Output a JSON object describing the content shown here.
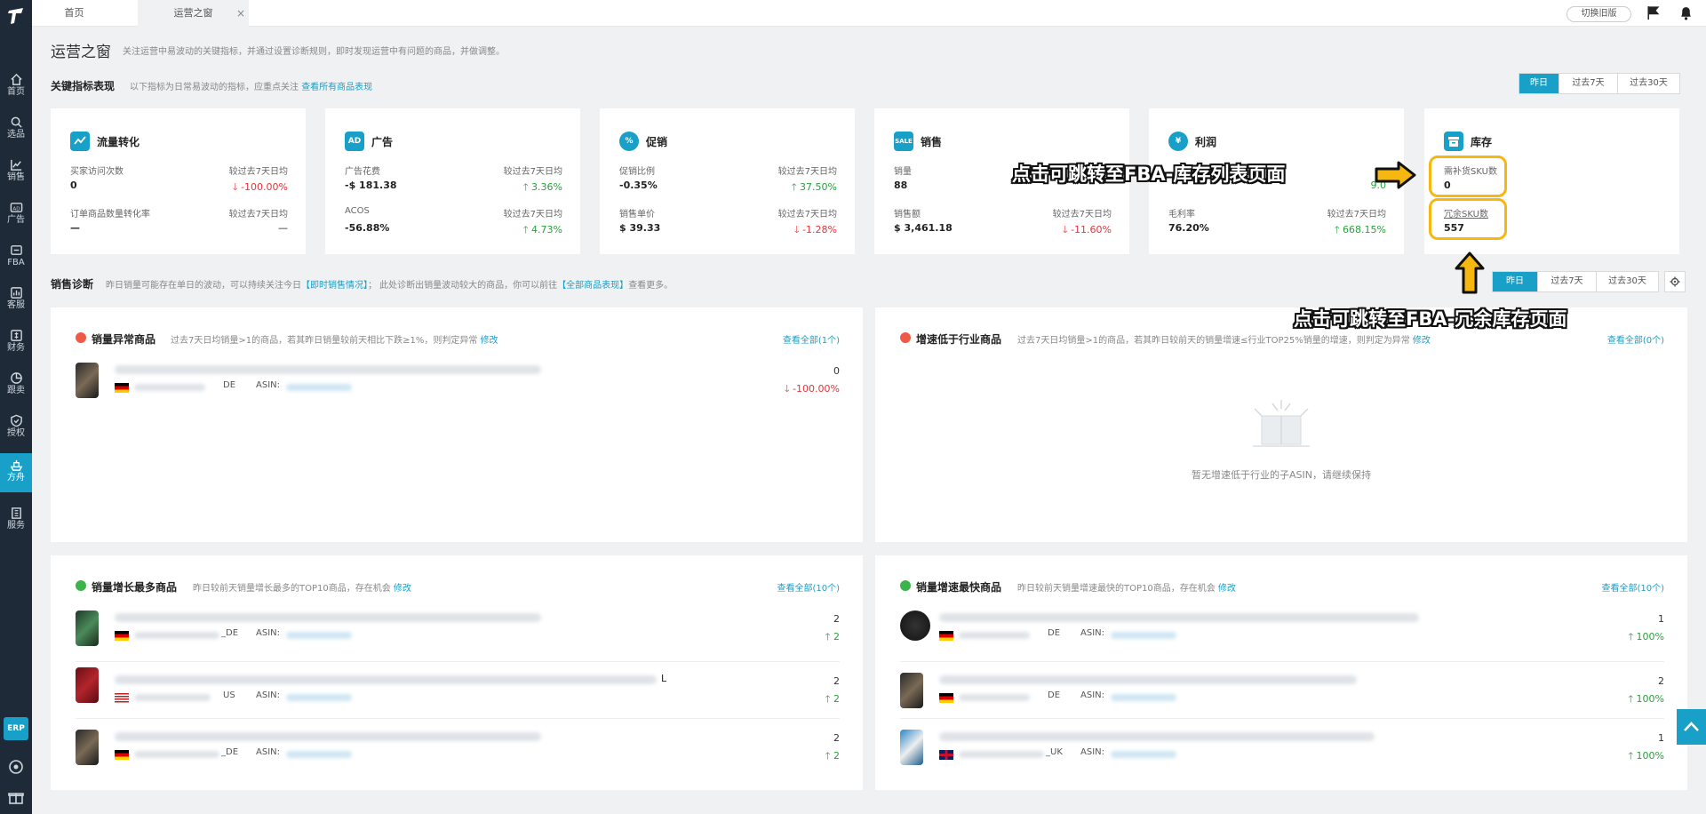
{
  "tabs": {
    "home": "首页",
    "ops": "运营之窗",
    "close": "×"
  },
  "topbar": {
    "old_version": "切换旧版"
  },
  "sidebar": {
    "items": [
      "首页",
      "选品",
      "销售",
      "广告",
      "FBA",
      "客服",
      "财务",
      "跟卖",
      "授权",
      "方舟",
      "服务"
    ],
    "active": "方舟",
    "erp": "ERP"
  },
  "page": {
    "title": "运营之窗",
    "desc": "关注运营中易波动的关键指标，并通过设置诊断规则，即时发现运营中有问题的商品，并做调整。"
  },
  "kpi": {
    "title": "关键指标表现",
    "desc": "以下指标为日常易波动的指标，应重点关注",
    "link": "查看所有商品表现",
    "periods": [
      "昨日",
      "过去7天",
      "过去30天"
    ],
    "active_period": "昨日",
    "compare_label": "较过去7天日均",
    "cards": [
      {
        "title": "流量转化",
        "icon": "traffic-icon",
        "m1": {
          "label": "买家访问次数",
          "value": "0",
          "change": "-100.00%",
          "dir": "down"
        },
        "m2": {
          "label": "订单商品数量转化率",
          "value": "—",
          "change": "—",
          "dir": "none"
        }
      },
      {
        "title": "广告",
        "icon": "ad-icon",
        "icon_text": "AD",
        "m1": {
          "label": "广告花费",
          "value": "-$ 181.38",
          "change": "3.36%",
          "dir": "up"
        },
        "m2": {
          "label": "ACOS",
          "value": "-56.88%",
          "change": "4.73%",
          "dir": "up"
        }
      },
      {
        "title": "促销",
        "icon": "promo-icon",
        "icon_text": "%",
        "m1": {
          "label": "促销比例",
          "value": "-0.35%",
          "change": "37.50%",
          "dir": "up"
        },
        "m2": {
          "label": "销售单价",
          "value": "$ 39.33",
          "change": "-1.28%",
          "dir": "down"
        }
      },
      {
        "title": "销售",
        "icon": "sale-icon",
        "icon_text": "SALE",
        "m1": {
          "label": "销量",
          "value": "88",
          "change": "",
          "dir": "down"
        },
        "m2": {
          "label": "销售额",
          "value": "$ 3,461.18",
          "change": "-11.60%",
          "dir": "down"
        }
      },
      {
        "title": "利润",
        "icon": "profit-icon",
        "icon_text": "¥",
        "m1": {
          "label": "",
          "value": "",
          "change": "9.0",
          "dir": "up"
        },
        "m2": {
          "label": "毛利率",
          "value": "76.20%",
          "change": "668.15%",
          "dir": "up"
        }
      },
      {
        "title": "库存",
        "icon": "inventory-icon",
        "m1": {
          "label": "需补货SKU数",
          "value": "0"
        },
        "m2": {
          "label": "冗余SKU数",
          "value": "557"
        }
      }
    ]
  },
  "diag": {
    "title": "销售诊断",
    "desc_a": "昨日销量可能存在单日的波动，可以持续关注今日",
    "link_a": "【即时销售情况】",
    "desc_b": "；  此处诊断出销量波动较大的商品，你可以前往",
    "link_b": "【全部商品表现】",
    "desc_c": "查看更多。",
    "periods": [
      "昨日",
      "过去7天",
      "过去30天"
    ],
    "active_period": "昨日"
  },
  "panels": {
    "abnormal": {
      "title": "销量异常商品",
      "desc": "过去7天日均销量>1的商品，若其昨日销量较前天相比下跌≥1%，则判定异常",
      "edit": "修改",
      "view_all": "查看全部(1个)",
      "rows": [
        {
          "suffix": "DE",
          "asin_label": "ASIN:",
          "num": "0",
          "change": "-100.00%",
          "dir": "down"
        }
      ]
    },
    "slow": {
      "title": "增速低于行业商品",
      "desc": "过去7天日均销量>1的商品，若其昨日较前天的销量增速≤行业TOP25%销量的增速，则判定为异常",
      "edit": "修改",
      "view_all": "查看全部(0个)",
      "empty": "暂无增速低于行业的子ASIN，请继续保持"
    },
    "growth": {
      "title": "销量增长最多商品",
      "desc": "昨日较前天销量增长最多的TOP10商品，存在机会",
      "edit": "修改",
      "view_all": "查看全部(10个)",
      "rows": [
        {
          "suffix": "_DE",
          "asin_label": "ASIN:",
          "num": "2",
          "change": "2",
          "dir": "up",
          "extra": ""
        },
        {
          "suffix": "US",
          "asin_label": "ASIN:",
          "num": "2",
          "change": "2",
          "dir": "up",
          "extra": "L"
        },
        {
          "suffix": "_DE",
          "asin_label": "ASIN:",
          "num": "2",
          "change": "2",
          "dir": "up",
          "extra": ""
        }
      ]
    },
    "fastest": {
      "title": "销量增速最快商品",
      "desc": "昨日较前天销量增速最快的TOP10商品，存在机会",
      "edit": "修改",
      "view_all": "查看全部(10个)",
      "rows": [
        {
          "suffix": "DE",
          "asin_label": "ASIN:",
          "num": "1",
          "change": "100%",
          "dir": "up"
        },
        {
          "suffix": "DE",
          "asin_label": "ASIN:",
          "num": "2",
          "change": "100%",
          "dir": "up"
        },
        {
          "suffix": "_UK",
          "asin_label": "ASIN:",
          "num": "1",
          "change": "100%",
          "dir": "up"
        }
      ]
    }
  },
  "callouts": {
    "top": "点击可跳转至FBA-库存列表页面",
    "bottom": "点击可跳转至FBA-冗余库存页面"
  },
  "colors": {
    "accent": "#19a0c8",
    "up": "#27a33a",
    "down": "#e8353a",
    "annotation": "#f7b711"
  }
}
